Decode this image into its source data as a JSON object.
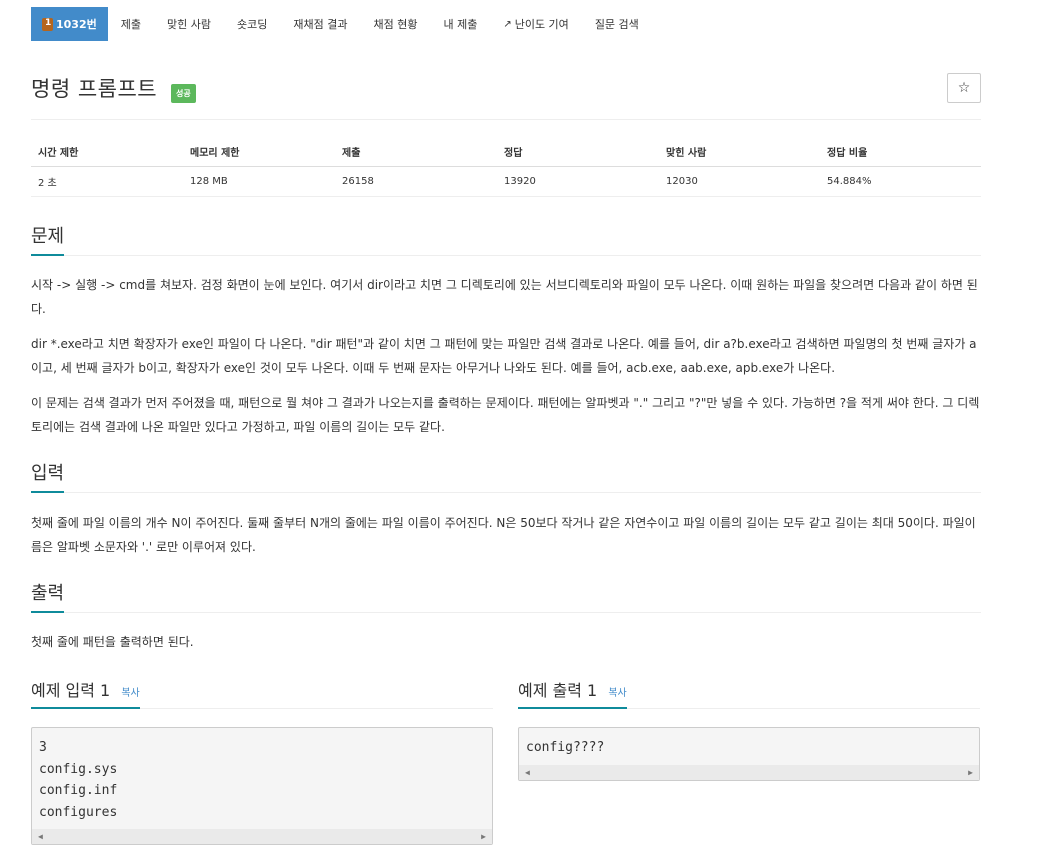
{
  "tabs": [
    {
      "label": "1032번",
      "active": true
    },
    {
      "label": "제출"
    },
    {
      "label": "맞힌 사람"
    },
    {
      "label": "숏코딩"
    },
    {
      "label": "재채점 결과"
    },
    {
      "label": "채점 현황"
    },
    {
      "label": "내 제출"
    },
    {
      "label": "난이도 기여"
    },
    {
      "label": "질문 검색"
    }
  ],
  "problem": {
    "title": "명령 프롬프트",
    "status_badge": "성공",
    "star": "☆"
  },
  "info": {
    "headers": [
      "시간 제한",
      "메모리 제한",
      "제출",
      "정답",
      "맞힌 사람",
      "정답 비율"
    ],
    "values": [
      "2 초",
      "128 MB",
      "26158",
      "13920",
      "12030",
      "54.884%"
    ]
  },
  "sections": {
    "problem_heading": "문제",
    "problem_p1": "시작 -> 실행 -> cmd를 쳐보자. 검정 화면이 눈에 보인다. 여기서 dir이라고 치면 그 디렉토리에 있는 서브디렉토리와 파일이 모두 나온다. 이때 원하는 파일을 찾으려면 다음과 같이 하면 된다.",
    "problem_p2": "dir *.exe라고 치면 확장자가 exe인 파일이 다 나온다. \"dir 패턴\"과 같이 치면 그 패턴에 맞는 파일만 검색 결과로 나온다. 예를 들어, dir a?b.exe라고 검색하면 파일명의 첫 번째 글자가 a이고, 세 번째 글자가 b이고, 확장자가 exe인 것이 모두 나온다. 이때 두 번째 문자는 아무거나 나와도 된다. 예를 들어, acb.exe, aab.exe, apb.exe가 나온다.",
    "problem_p3": "이 문제는 검색 결과가 먼저 주어졌을 때, 패턴으로 뭘 쳐야 그 결과가 나오는지를 출력하는 문제이다. 패턴에는 알파벳과 \".\" 그리고 \"?\"만 넣을 수 있다. 가능하면 ?을 적게 써야 한다. 그 디렉토리에는 검색 결과에 나온 파일만 있다고 가정하고, 파일 이름의 길이는 모두 같다.",
    "input_heading": "입력",
    "input_p": "첫째 줄에 파일 이름의 개수 N이 주어진다. 둘째 줄부터 N개의 줄에는 파일 이름이 주어진다. N은 50보다 작거나 같은 자연수이고 파일 이름의 길이는 모두 같고 길이는 최대 50이다. 파일이름은 알파벳 소문자와 '.' 로만 이루어져 있다.",
    "output_heading": "출력",
    "output_p": "첫째 줄에 패턴을 출력하면 된다."
  },
  "examples": {
    "input_heading": "예제 입력 1",
    "output_heading": "예제 출력 1",
    "copy_label": "복사",
    "input_code": "3\nconfig.sys\nconfig.inf\nconfigures",
    "output_code": "config????"
  }
}
